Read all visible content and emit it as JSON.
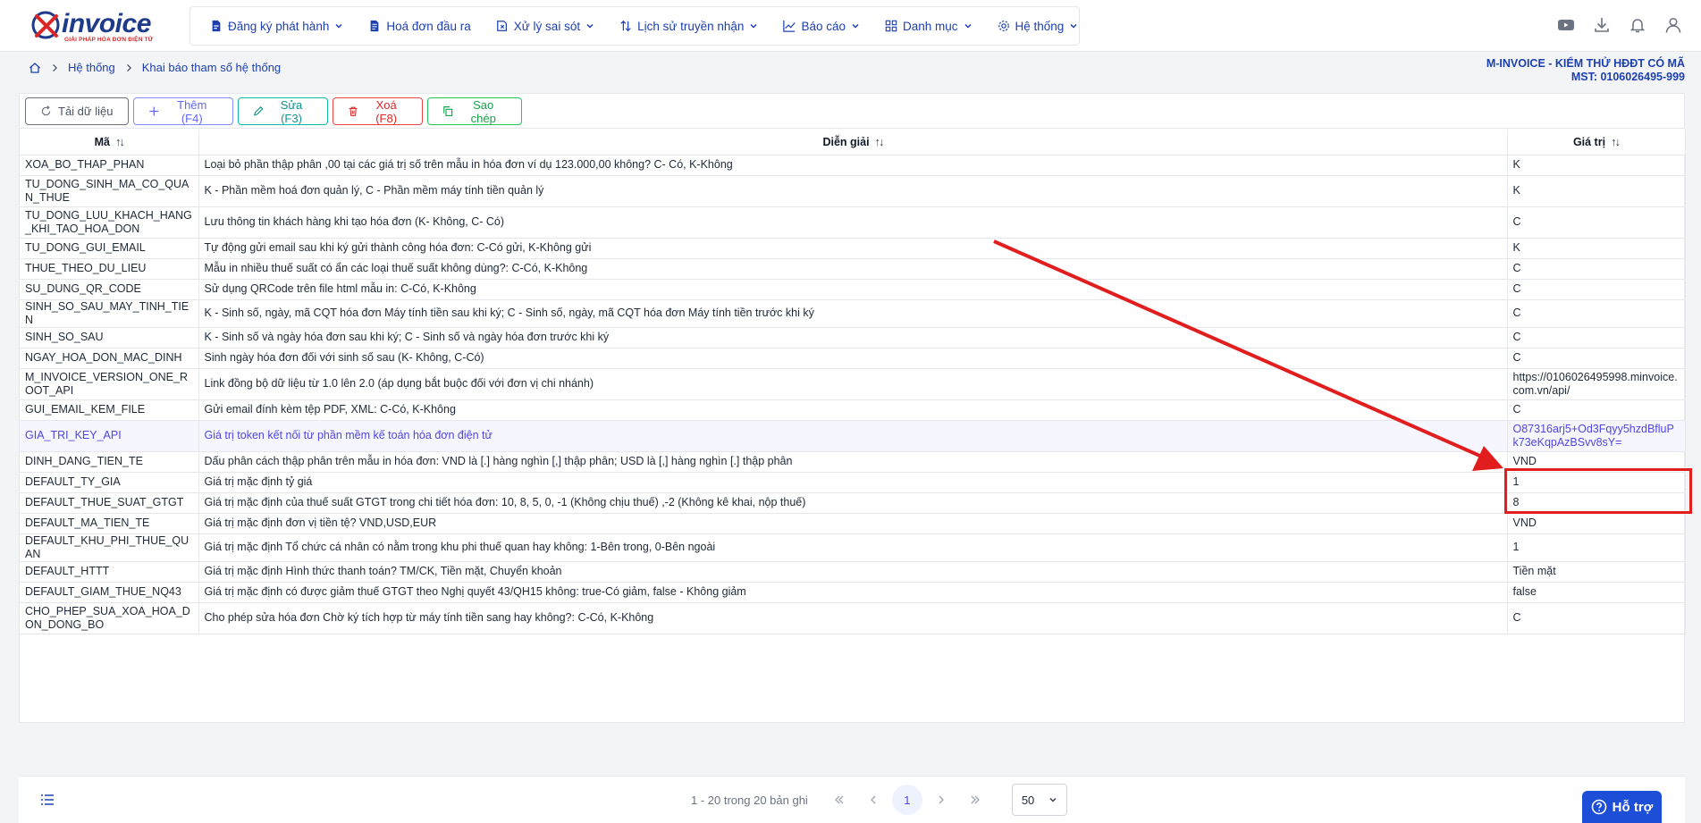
{
  "logo": {
    "brand": "invoice",
    "tagline": "GIẢI PHÁP HÓA ĐƠN ĐIỆN TỬ"
  },
  "nav": [
    {
      "label": "Đăng ký phát hành",
      "icon": "document-register-icon",
      "dropdown": true
    },
    {
      "label": "Hoá đơn đầu ra",
      "icon": "invoice-file-icon",
      "dropdown": false
    },
    {
      "label": "Xử lý sai sót",
      "icon": "error-fix-icon",
      "dropdown": true
    },
    {
      "label": "Lịch sử truyền nhận",
      "icon": "transfer-history-icon",
      "dropdown": true
    },
    {
      "label": "Báo cáo",
      "icon": "report-chart-icon",
      "dropdown": true
    },
    {
      "label": "Danh mục",
      "icon": "grid-category-icon",
      "dropdown": true
    },
    {
      "label": "Hệ thống",
      "icon": "gear-icon",
      "dropdown": true
    }
  ],
  "breadcrumb": {
    "level1": "Hệ thống",
    "level2": "Khai báo tham số hệ thống"
  },
  "company": {
    "name": "M-INVOICE - KIỂM THỬ HĐĐT CÓ MÃ",
    "tax_id": "MST: 0106026495-999"
  },
  "toolbar": {
    "reload": "Tải dữ liệu",
    "add": "Thêm (F4)",
    "edit": "Sửa (F3)",
    "delete": "Xoá (F8)",
    "copy": "Sao chép"
  },
  "table": {
    "headers": {
      "code": "Mã",
      "description": "Diễn giải",
      "value": "Giá trị"
    },
    "rows": [
      {
        "code": "XOA_BO_THAP_PHAN",
        "description": "Loại bỏ phần thập phân ,00 tại các giá trị số trên mẫu in hóa đơn ví dụ 123.000,00 không? C- Có, K-Không",
        "value": "K"
      },
      {
        "code": "TU_DONG_SINH_MA_CO_QUAN_THUE",
        "description": "K - Phần mềm hoá đơn quản lý, C - Phần mềm máy tính tiền quản lý",
        "value": "K"
      },
      {
        "code": "TU_DONG_LUU_KHACH_HANG_KHI_TAO_HOA_DON",
        "description": "Lưu thông tin khách hàng khi tạo hóa đơn (K- Không, C- Có)",
        "value": "C"
      },
      {
        "code": "TU_DONG_GUI_EMAIL",
        "description": "Tự động gửi email sau khi ký gửi thành công hóa đơn: C-Có gửi, K-Không gửi",
        "value": "K"
      },
      {
        "code": "THUE_THEO_DU_LIEU",
        "description": "Mẫu in nhiều thuế suất có ẩn các loại thuế suất không dùng?: C-Có, K-Không",
        "value": "C"
      },
      {
        "code": "SU_DUNG_QR_CODE",
        "description": "Sử dụng QRCode trên file html mẫu in: C-Có, K-Không",
        "value": "C"
      },
      {
        "code": "SINH_SO_SAU_MAY_TINH_TIEN",
        "description": "K - Sinh số, ngày, mã CQT  hóa đơn Máy tính tiền sau khi ký; C - Sinh số, ngày, mã CQT hóa đơn Máy tính tiền trước khi ký",
        "value": "C"
      },
      {
        "code": "SINH_SO_SAU",
        "description": "K - Sinh số và ngày hóa đơn sau khi ký; C - Sinh số và ngày hóa đơn trước khi ký",
        "value": "C"
      },
      {
        "code": "NGAY_HOA_DON_MAC_DINH",
        "description": "Sinh ngày hóa đơn đối với sinh số sau (K- Không, C-Có)",
        "value": "C"
      },
      {
        "code": "M_INVOICE_VERSION_ONE_ROOT_API",
        "description": "Link đồng bộ dữ liệu từ 1.0 lên 2.0 (áp dụng bắt buộc đối với đơn vị chi nhánh)",
        "value": "https://0106026495998.minvoice.com.vn/api/"
      },
      {
        "code": "GUI_EMAIL_KEM_FILE",
        "description": "Gửi email đính kèm tệp PDF, XML: C-Có, K-Không",
        "value": "C"
      },
      {
        "code": "GIA_TRI_KEY_API",
        "description": "Giá trị token kết nối từ phần mềm kế toán hóa đơn điện tử",
        "value": "O87316arj5+Od3Fqyy5hzdBfluPk73eKqpAzBSvv8sY=",
        "selected": true
      },
      {
        "code": "DINH_DANG_TIEN_TE",
        "description": "Dấu phân cách thập phân trên mẫu in hóa đơn: VND là [.] hàng nghìn [,] thập phân; USD là [,] hàng nghìn [.] thập phân",
        "value": "VND"
      },
      {
        "code": "DEFAULT_TY_GIA",
        "description": "Giá trị mặc định tỷ giá",
        "value": "1"
      },
      {
        "code": "DEFAULT_THUE_SUAT_GTGT",
        "description": "Giá trị mặc định của thuế suất GTGT trong chi tiết hóa đơn: 10, 8, 5, 0, -1 (Không chịu thuế) ,-2 (Không kê khai, nộp thuế)",
        "value": "8"
      },
      {
        "code": "DEFAULT_MA_TIEN_TE",
        "description": "Giá trị mặc định đơn vị tiền tệ? VND,USD,EUR",
        "value": "VND"
      },
      {
        "code": "DEFAULT_KHU_PHI_THUE_QUAN",
        "description": "Giá trị mặc định Tổ chức cá nhân có nằm trong khu phi thuế quan hay không: 1-Bên trong, 0-Bên ngoài",
        "value": "1"
      },
      {
        "code": "DEFAULT_HTTT",
        "description": "Giá trị mặc định Hình thức thanh toán? TM/CK, Tiền mặt, Chuyển khoản",
        "value": "Tiền mặt"
      },
      {
        "code": "DEFAULT_GIAM_THUE_NQ43",
        "description": "Giá trị mặc định có được giảm thuế GTGT theo Nghị quyết 43/QH15 không: true-Có giảm, false - Không giảm",
        "value": "false"
      },
      {
        "code": "CHO_PHEP_SUA_XOA_HOA_DON_DONG_BO",
        "description": "Cho phép sửa hóa đơn Chờ ký tích hợp từ máy tính tiền sang hay không?: C-Có, K-Không",
        "value": "C"
      }
    ]
  },
  "pager": {
    "info": "1 - 20 trong 20 bản ghi",
    "current_page": "1",
    "page_size": "50"
  },
  "help": {
    "label": "Hỗ trợ"
  },
  "colors": {
    "accent": "#1e40af",
    "annotation": "#e11d1d",
    "selected_text": "#4f46e5"
  }
}
